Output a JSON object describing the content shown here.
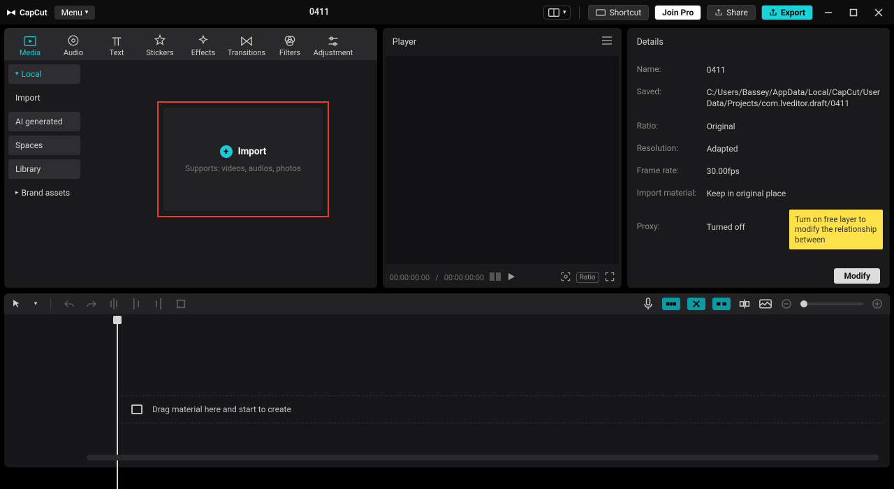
{
  "titlebar": {
    "brand": "CapCut",
    "menu": "Menu",
    "project_title": "0411",
    "shortcut": "Shortcut",
    "join_pro": "Join Pro",
    "share": "Share",
    "export": "Export"
  },
  "top_tabs": {
    "media": "Media",
    "audio": "Audio",
    "text": "Text",
    "stickers": "Stickers",
    "effects": "Effects",
    "transitions": "Transitions",
    "filters": "Filters",
    "adjustment": "Adjustment"
  },
  "sidebar": {
    "local": "Local",
    "import": "Import",
    "ai": "AI generated",
    "spaces": "Spaces",
    "library": "Library",
    "brand": "Brand assets"
  },
  "import_box": {
    "title": "Import",
    "subtitle": "Supports: videos, audios, photos"
  },
  "player": {
    "title": "Player",
    "time_current": "00:00:00:00",
    "time_total": "00:00:00:00",
    "ratio_label": "Ratio"
  },
  "details": {
    "title": "Details",
    "name_label": "Name:",
    "name_value": "0411",
    "saved_label": "Saved:",
    "saved_value": "C:/Users/Bassey/AppData/Local/CapCut/User Data/Projects/com.lveditor.draft/0411",
    "ratio_label": "Ratio:",
    "ratio_value": "Original",
    "resolution_label": "Resolution:",
    "resolution_value": "Adapted",
    "framerate_label": "Frame rate:",
    "framerate_value": "30.00fps",
    "importmat_label": "Import material:",
    "importmat_value": "Keep in original place",
    "proxy_label": "Proxy:",
    "proxy_value": "Turned off",
    "modify": "Modify"
  },
  "tooltip": {
    "text": "Turn on free layer to modify the relationship between"
  },
  "timeline": {
    "lane_hint": "Drag material here and start to create"
  }
}
